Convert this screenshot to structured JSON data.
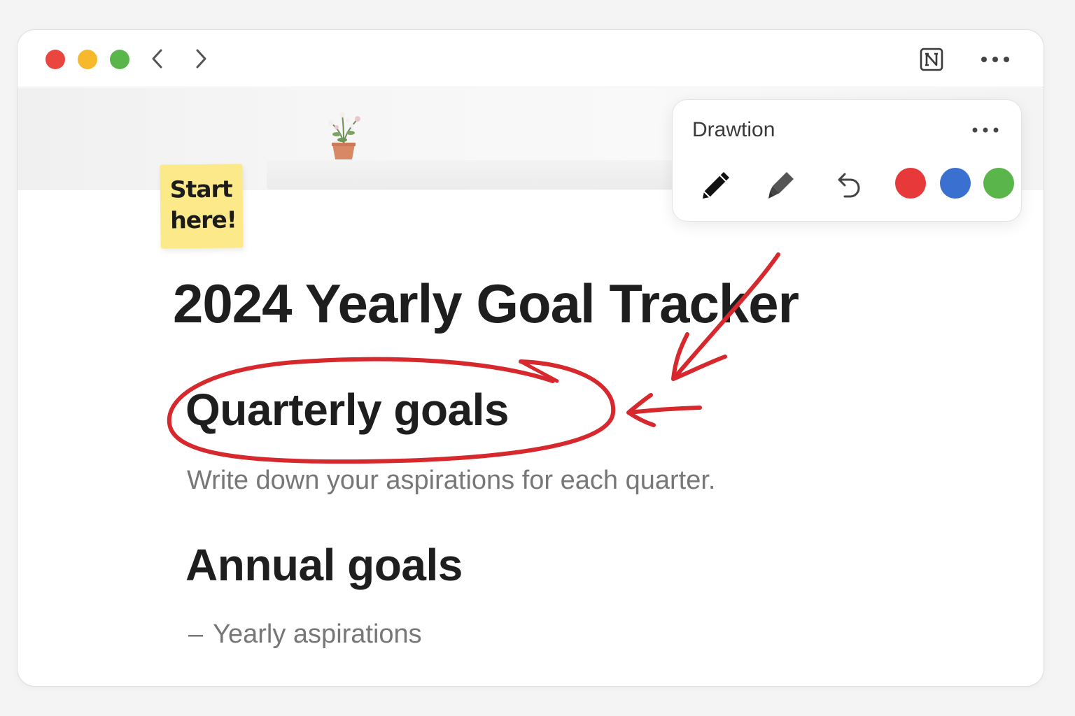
{
  "window": {
    "controls": {
      "close_color": "#e8463f",
      "minimize_color": "#f6b92b",
      "zoom_color": "#5ab54a"
    },
    "nav": {
      "back_icon": "chevron-left-icon",
      "forward_icon": "chevron-right-icon"
    },
    "toolbar": {
      "notion_icon": "notion-logo-icon",
      "more_icon": "more-horizontal-icon"
    }
  },
  "sticky_note": {
    "line1": "Start",
    "line2": "here!"
  },
  "drawing_palette": {
    "title": "Drawtion",
    "tools": [
      "pen-icon",
      "marker-icon",
      "undo-icon"
    ],
    "colors": [
      "#e8393a",
      "#3a70d0",
      "#5ab54a"
    ]
  },
  "page": {
    "title": "2024 Yearly Goal Tracker",
    "sections": [
      {
        "heading": "Quarterly goals",
        "text": "Write down your aspirations for each quarter."
      },
      {
        "heading": "Annual goals",
        "bullet": "Yearly aspirations"
      }
    ]
  },
  "annotation_color": "#d6282d"
}
